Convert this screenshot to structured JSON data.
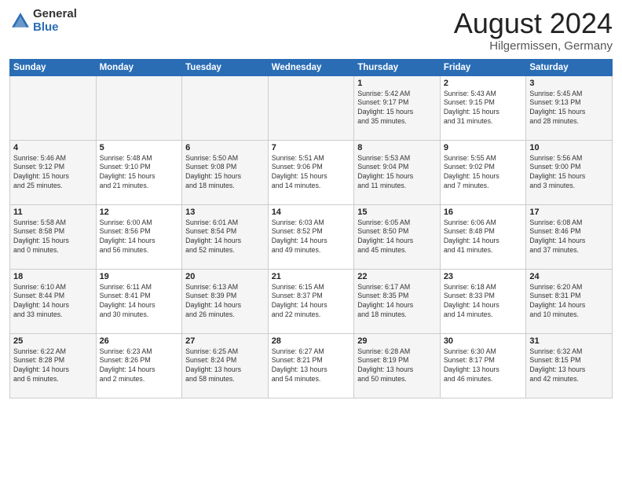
{
  "header": {
    "logo_general": "General",
    "logo_blue": "Blue",
    "month_title": "August 2024",
    "location": "Hilgermissen, Germany"
  },
  "days_of_week": [
    "Sunday",
    "Monday",
    "Tuesday",
    "Wednesday",
    "Thursday",
    "Friday",
    "Saturday"
  ],
  "weeks": [
    [
      {
        "day": "",
        "info": ""
      },
      {
        "day": "",
        "info": ""
      },
      {
        "day": "",
        "info": ""
      },
      {
        "day": "",
        "info": ""
      },
      {
        "day": "1",
        "info": "Sunrise: 5:42 AM\nSunset: 9:17 PM\nDaylight: 15 hours\nand 35 minutes."
      },
      {
        "day": "2",
        "info": "Sunrise: 5:43 AM\nSunset: 9:15 PM\nDaylight: 15 hours\nand 31 minutes."
      },
      {
        "day": "3",
        "info": "Sunrise: 5:45 AM\nSunset: 9:13 PM\nDaylight: 15 hours\nand 28 minutes."
      }
    ],
    [
      {
        "day": "4",
        "info": "Sunrise: 5:46 AM\nSunset: 9:12 PM\nDaylight: 15 hours\nand 25 minutes."
      },
      {
        "day": "5",
        "info": "Sunrise: 5:48 AM\nSunset: 9:10 PM\nDaylight: 15 hours\nand 21 minutes."
      },
      {
        "day": "6",
        "info": "Sunrise: 5:50 AM\nSunset: 9:08 PM\nDaylight: 15 hours\nand 18 minutes."
      },
      {
        "day": "7",
        "info": "Sunrise: 5:51 AM\nSunset: 9:06 PM\nDaylight: 15 hours\nand 14 minutes."
      },
      {
        "day": "8",
        "info": "Sunrise: 5:53 AM\nSunset: 9:04 PM\nDaylight: 15 hours\nand 11 minutes."
      },
      {
        "day": "9",
        "info": "Sunrise: 5:55 AM\nSunset: 9:02 PM\nDaylight: 15 hours\nand 7 minutes."
      },
      {
        "day": "10",
        "info": "Sunrise: 5:56 AM\nSunset: 9:00 PM\nDaylight: 15 hours\nand 3 minutes."
      }
    ],
    [
      {
        "day": "11",
        "info": "Sunrise: 5:58 AM\nSunset: 8:58 PM\nDaylight: 15 hours\nand 0 minutes."
      },
      {
        "day": "12",
        "info": "Sunrise: 6:00 AM\nSunset: 8:56 PM\nDaylight: 14 hours\nand 56 minutes."
      },
      {
        "day": "13",
        "info": "Sunrise: 6:01 AM\nSunset: 8:54 PM\nDaylight: 14 hours\nand 52 minutes."
      },
      {
        "day": "14",
        "info": "Sunrise: 6:03 AM\nSunset: 8:52 PM\nDaylight: 14 hours\nand 49 minutes."
      },
      {
        "day": "15",
        "info": "Sunrise: 6:05 AM\nSunset: 8:50 PM\nDaylight: 14 hours\nand 45 minutes."
      },
      {
        "day": "16",
        "info": "Sunrise: 6:06 AM\nSunset: 8:48 PM\nDaylight: 14 hours\nand 41 minutes."
      },
      {
        "day": "17",
        "info": "Sunrise: 6:08 AM\nSunset: 8:46 PM\nDaylight: 14 hours\nand 37 minutes."
      }
    ],
    [
      {
        "day": "18",
        "info": "Sunrise: 6:10 AM\nSunset: 8:44 PM\nDaylight: 14 hours\nand 33 minutes."
      },
      {
        "day": "19",
        "info": "Sunrise: 6:11 AM\nSunset: 8:41 PM\nDaylight: 14 hours\nand 30 minutes."
      },
      {
        "day": "20",
        "info": "Sunrise: 6:13 AM\nSunset: 8:39 PM\nDaylight: 14 hours\nand 26 minutes."
      },
      {
        "day": "21",
        "info": "Sunrise: 6:15 AM\nSunset: 8:37 PM\nDaylight: 14 hours\nand 22 minutes."
      },
      {
        "day": "22",
        "info": "Sunrise: 6:17 AM\nSunset: 8:35 PM\nDaylight: 14 hours\nand 18 minutes."
      },
      {
        "day": "23",
        "info": "Sunrise: 6:18 AM\nSunset: 8:33 PM\nDaylight: 14 hours\nand 14 minutes."
      },
      {
        "day": "24",
        "info": "Sunrise: 6:20 AM\nSunset: 8:31 PM\nDaylight: 14 hours\nand 10 minutes."
      }
    ],
    [
      {
        "day": "25",
        "info": "Sunrise: 6:22 AM\nSunset: 8:28 PM\nDaylight: 14 hours\nand 6 minutes."
      },
      {
        "day": "26",
        "info": "Sunrise: 6:23 AM\nSunset: 8:26 PM\nDaylight: 14 hours\nand 2 minutes."
      },
      {
        "day": "27",
        "info": "Sunrise: 6:25 AM\nSunset: 8:24 PM\nDaylight: 13 hours\nand 58 minutes."
      },
      {
        "day": "28",
        "info": "Sunrise: 6:27 AM\nSunset: 8:21 PM\nDaylight: 13 hours\nand 54 minutes."
      },
      {
        "day": "29",
        "info": "Sunrise: 6:28 AM\nSunset: 8:19 PM\nDaylight: 13 hours\nand 50 minutes."
      },
      {
        "day": "30",
        "info": "Sunrise: 6:30 AM\nSunset: 8:17 PM\nDaylight: 13 hours\nand 46 minutes."
      },
      {
        "day": "31",
        "info": "Sunrise: 6:32 AM\nSunset: 8:15 PM\nDaylight: 13 hours\nand 42 minutes."
      }
    ]
  ]
}
